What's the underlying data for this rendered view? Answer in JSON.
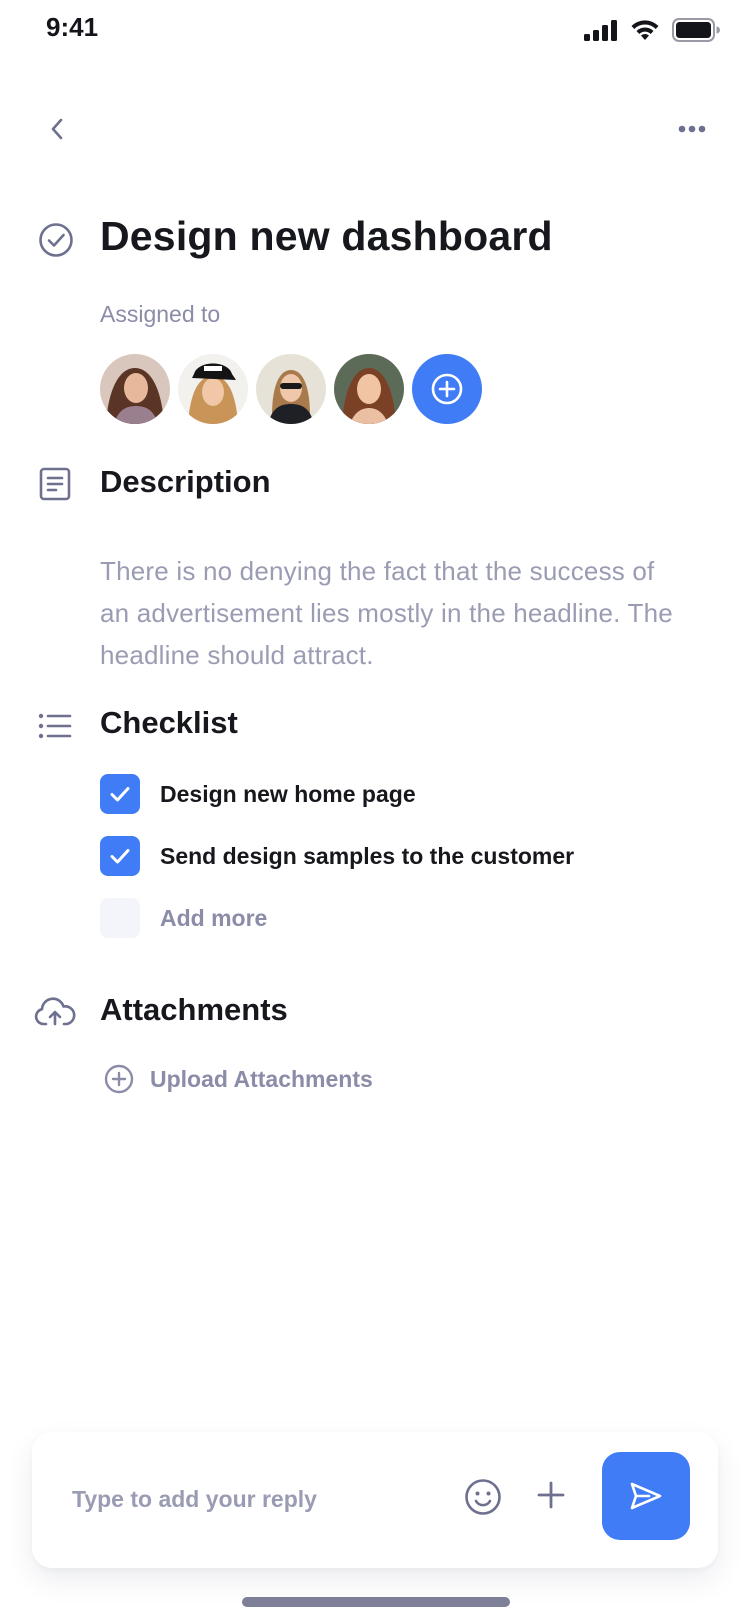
{
  "status_bar": {
    "time": "9:41"
  },
  "header": {
    "back_icon": "chevron-left-icon",
    "more_icon": "more-horizontal-icon"
  },
  "task": {
    "title": "Design new dashboard",
    "status_icon": "check-circle-icon"
  },
  "assignees": {
    "label": "Assigned to",
    "add_icon": "plus-circle-icon"
  },
  "description": {
    "heading": "Description",
    "icon": "document-icon",
    "text": "There is no denying the fact that the success of an advertisement lies mostly in the headline. The headline should attract."
  },
  "checklist": {
    "heading": "Checklist",
    "icon": "list-icon",
    "items": [
      {
        "label": "Design new home page",
        "checked": true
      },
      {
        "label": "Send design samples to the customer",
        "checked": true
      }
    ],
    "add_more_label": "Add more"
  },
  "attachments": {
    "heading": "Attachments",
    "icon": "cloud-upload-icon",
    "upload_label": "Upload Attachments"
  },
  "reply": {
    "placeholder": "Type to add your reply",
    "emoji_icon": "smile-icon",
    "plus_icon": "plus-icon",
    "send_icon": "send-icon"
  },
  "colors": {
    "accent": "#3f7cf5",
    "muted_text": "#8a8ca8",
    "heading_text": "#17181d"
  }
}
